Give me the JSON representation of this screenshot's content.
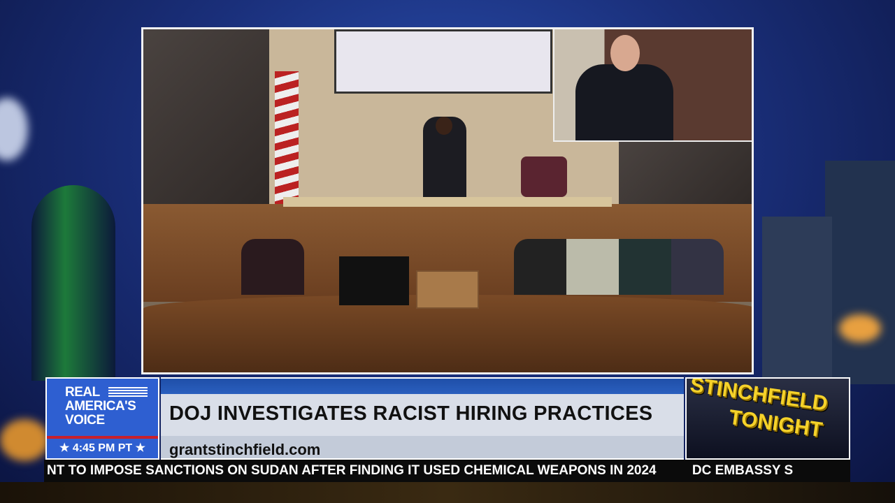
{
  "network": {
    "name": "REAL AMERICA'S VOICE",
    "line1": "REAL",
    "line2": "AMERICA'S",
    "line3": "VOICE",
    "time": "4:45 PM PT"
  },
  "headline": {
    "title": "DOJ INVESTIGATES RACIST HIRING PRACTICES",
    "url": "grantstinchfield.com"
  },
  "show": {
    "line1": "STINCHFIELD",
    "line2": "TONIGHT"
  },
  "ticker": {
    "items": [
      "NT TO IMPOSE SANCTIONS ON SUDAN AFTER FINDING IT USED CHEMICAL WEAPONS IN 2024",
      "DC EMBASSY S"
    ]
  },
  "colors": {
    "brand_blue": "#2e5fd1",
    "accent_red": "#c8202c",
    "show_yellow": "#f5d22a"
  }
}
